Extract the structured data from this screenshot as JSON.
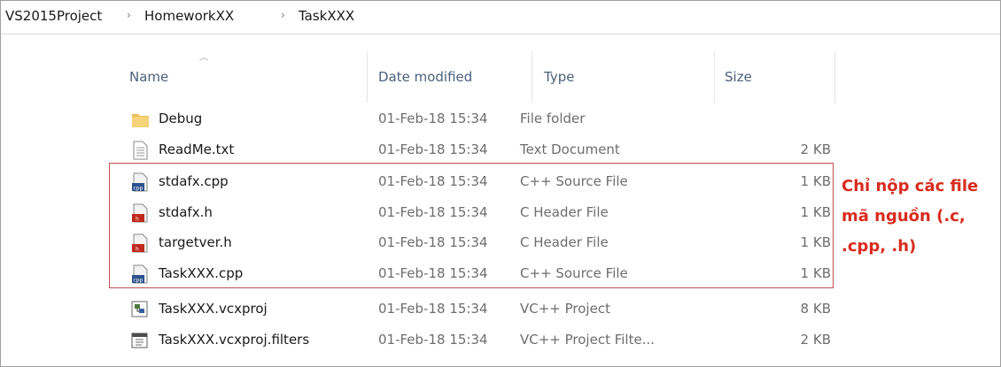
{
  "breadcrumb": {
    "items": [
      "VS2015Project",
      "HomeworkXX",
      "TaskXXX"
    ],
    "separator": "›"
  },
  "columns": {
    "name": "Name",
    "date": "Date modified",
    "type": "Type",
    "size": "Size"
  },
  "files": [
    {
      "name": "Debug",
      "date": "01-Feb-18 15:34",
      "type": "File folder",
      "size": "",
      "icon": "folder-icon"
    },
    {
      "name": "ReadMe.txt",
      "date": "01-Feb-18 15:34",
      "type": "Text Document",
      "size": "2 KB",
      "icon": "text-file-icon"
    },
    {
      "name": "stdafx.cpp",
      "date": "01-Feb-18 15:34",
      "type": "C++ Source File",
      "size": "1 KB",
      "icon": "cpp-file-icon"
    },
    {
      "name": "stdafx.h",
      "date": "01-Feb-18 15:34",
      "type": "C Header File",
      "size": "1 KB",
      "icon": "header-file-icon"
    },
    {
      "name": "targetver.h",
      "date": "01-Feb-18 15:34",
      "type": "C Header File",
      "size": "1 KB",
      "icon": "header-file-icon"
    },
    {
      "name": "TaskXXX.cpp",
      "date": "01-Feb-18 15:34",
      "type": "C++ Source File",
      "size": "1 KB",
      "icon": "cpp-file-icon"
    },
    {
      "name": "TaskXXX.vcxproj",
      "date": "01-Feb-18 15:34",
      "type": "VC++ Project",
      "size": "8 KB",
      "icon": "vcxproj-file-icon"
    },
    {
      "name": "TaskXXX.vcxproj.filters",
      "date": "01-Feb-18 15:34",
      "type": "VC++ Project Filte...",
      "size": "2 KB",
      "icon": "filters-file-icon"
    }
  ],
  "annotation": {
    "lines": [
      "Chỉ nộp các file",
      "mã nguồn (.c,",
      ".cpp, .h)"
    ],
    "color": "#d92b1e"
  },
  "colors": {
    "highlight_border": "#c0504d",
    "header_text": "#4c607a",
    "folder": "#e8c15a"
  }
}
